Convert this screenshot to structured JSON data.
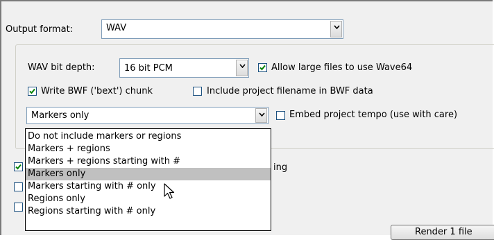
{
  "output_format": {
    "label": "Output format:",
    "value": "WAV"
  },
  "wav_bit_depth": {
    "label": "WAV bit depth:",
    "value": "16 bit PCM"
  },
  "allow_large_files": {
    "label": "Allow large files to use Wave64",
    "checked": true
  },
  "write_bwf": {
    "label": "Write BWF ('bext') chunk",
    "checked": true
  },
  "include_project_filename": {
    "label": "Include project filename in BWF data",
    "checked": false
  },
  "markers_select": {
    "value": "Markers only"
  },
  "embed_tempo": {
    "label": "Embed project tempo (use with care)",
    "checked": false
  },
  "dropdown": {
    "options": [
      "Do not include markers or regions",
      "Markers + regions",
      "Markers + regions starting with #",
      "Markers only",
      "Markers starting with # only",
      "Regions only",
      "Regions starting with # only"
    ],
    "selected_index": 3
  },
  "partial_text": {
    "behind_label": "ing"
  },
  "lower_checkboxes": [
    {
      "checked": true
    },
    {
      "checked": false
    },
    {
      "checked": false
    }
  ],
  "render_button": {
    "label": "Render 1 file"
  },
  "colors": {
    "accent_check": "#008000",
    "selection": "#c0c0c0",
    "combo_border": "#7f9db9"
  }
}
